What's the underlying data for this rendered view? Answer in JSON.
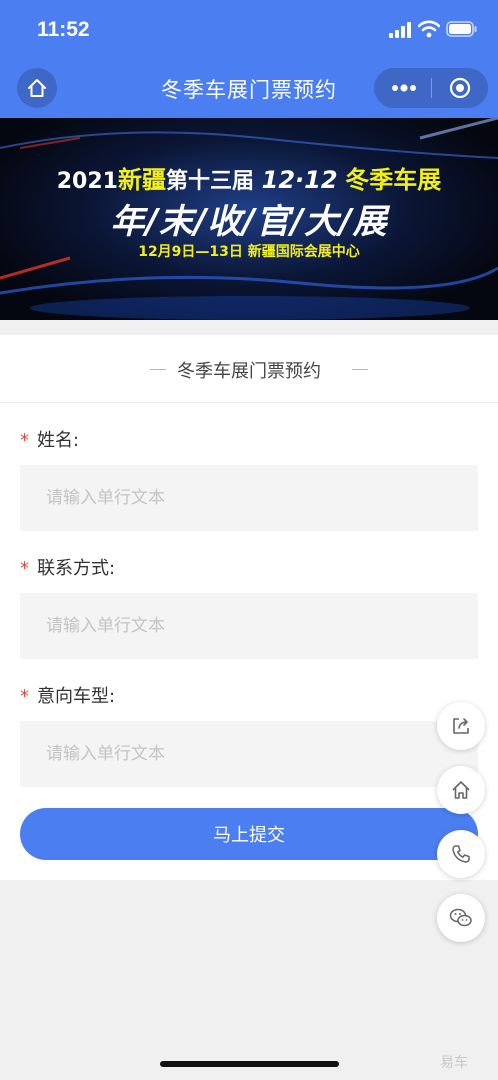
{
  "status_bar": {
    "time": "11:52"
  },
  "nav": {
    "title": "冬季车展门票预约"
  },
  "banner": {
    "line1_prefix": "2021",
    "line1_region": "新疆",
    "line1_edition": "第十三届",
    "line1_date": "12·12",
    "line1_event": "冬季车展",
    "line2": "年/末/收/官/大/展",
    "line3": "12月9日—13日   新疆国际会展中心"
  },
  "form": {
    "title": "冬季车展门票预约",
    "required_mark": "*",
    "fields": [
      {
        "label": "姓名:",
        "placeholder": "请输入单行文本",
        "value": ""
      },
      {
        "label": "联系方式:",
        "placeholder": "请输入单行文本",
        "value": ""
      },
      {
        "label": "意向车型:",
        "placeholder": "请输入单行文本",
        "value": ""
      }
    ],
    "submit_label": "马上提交"
  },
  "float_actions": [
    "share-icon",
    "home-icon",
    "phone-icon",
    "wechat-icon"
  ],
  "watermark": "易车",
  "colors": {
    "primary": "#4b7ef0",
    "required": "#e24a3b",
    "banner_accent": "#f2ee18"
  }
}
